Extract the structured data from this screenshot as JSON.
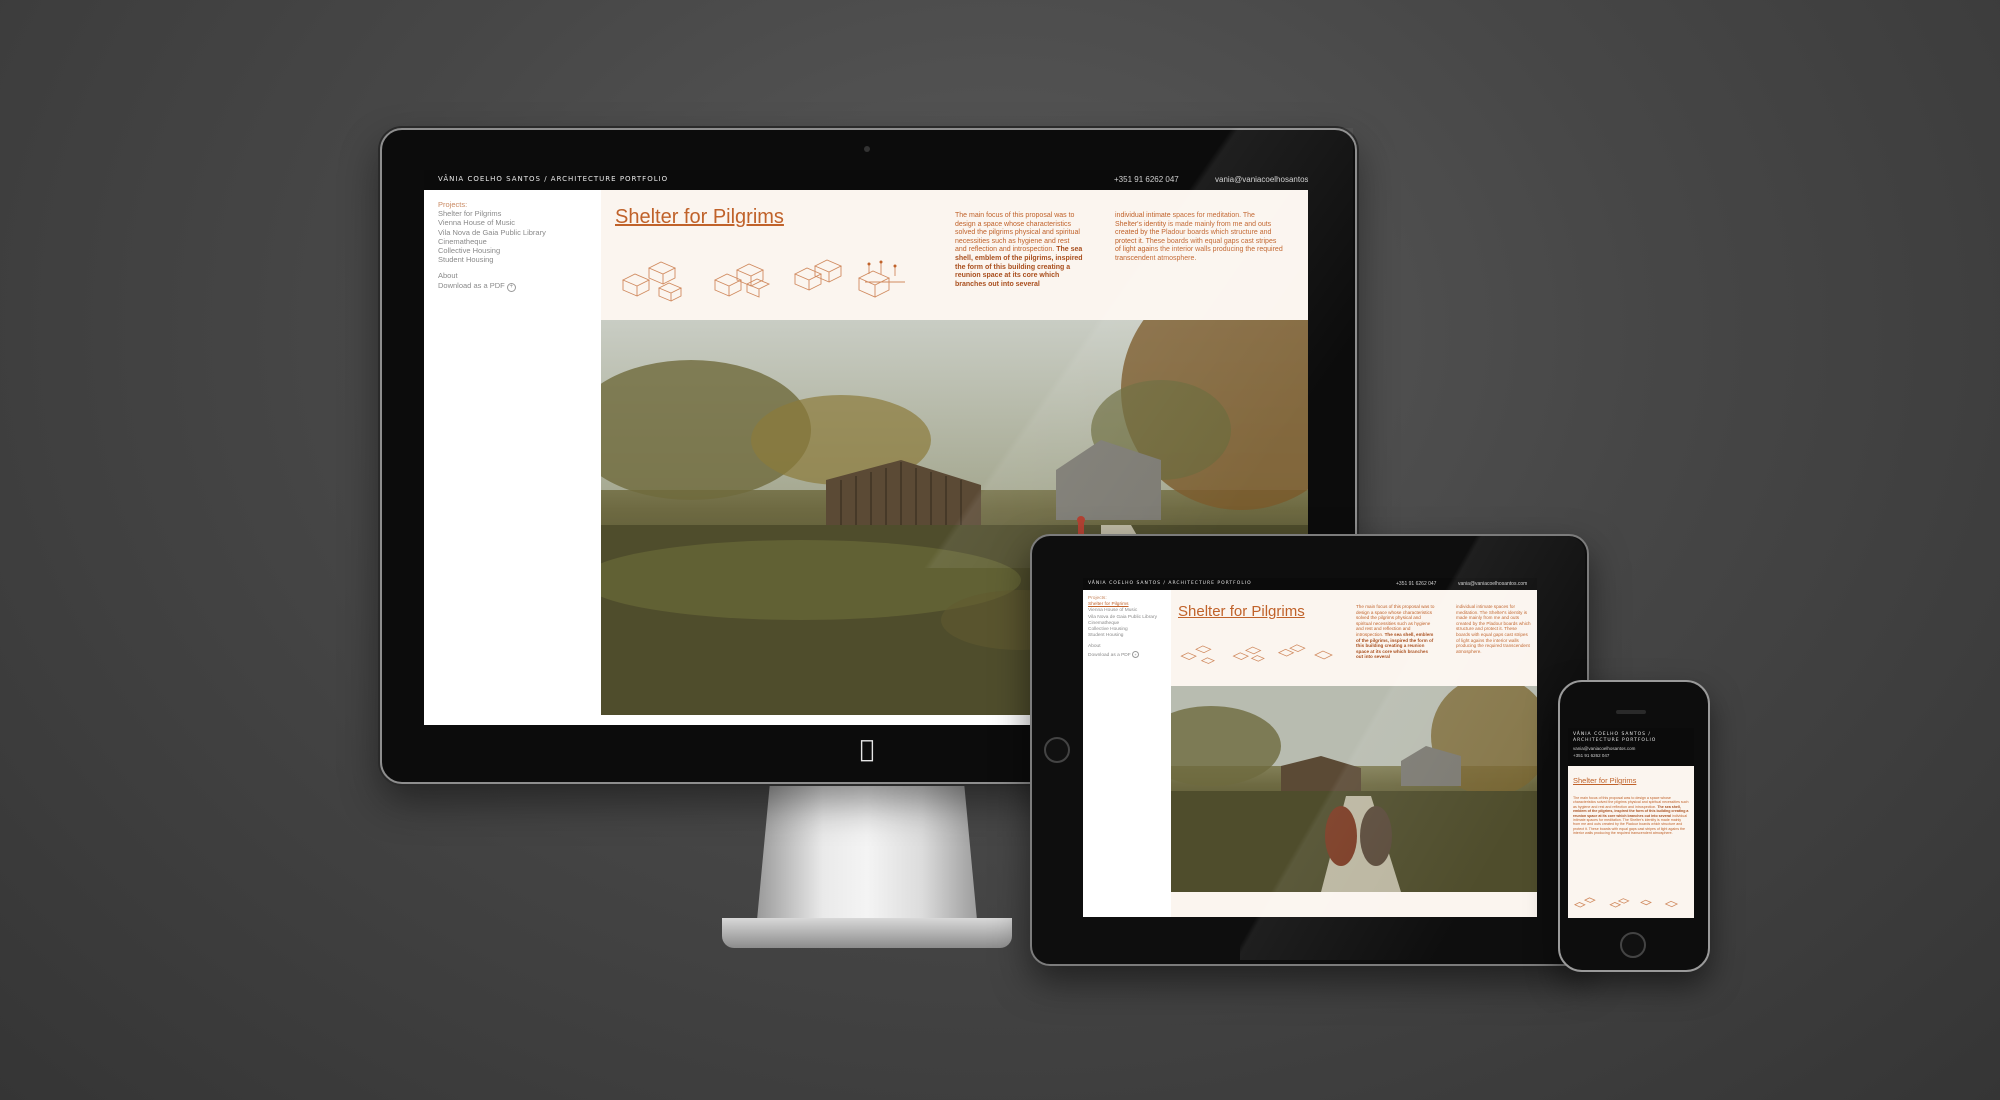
{
  "site": {
    "brand": "VÂNIA COELHO SANTOS  /  ARCHITECTURE PORTFOLIO",
    "brand_line1": "VÂNIA COELHO SANTOS  /",
    "brand_line2": "ARCHITECTURE PORTFOLIO",
    "phone": "+351 91 6262 047",
    "email": "vania@vaniacoelhosantos.com"
  },
  "nav": {
    "heading": "Projects:",
    "items": [
      "Shelter for Pilgrims",
      "Vienna House of Music",
      "Vila Nova de Gaia Public Library",
      "Cinematheque",
      "Collective Housing",
      "Student Housing"
    ],
    "about": "About",
    "download": "Download as a PDF",
    "download_icon": "+"
  },
  "project": {
    "title": "Shelter for Pilgrims",
    "text_col1_a": "The main focus of this proposal was to design a space whose characteristics solved the pilgrims physical and spiritual necessities such as hygiene and rest and reflection and introspection.",
    "text_col1_b": "The sea shell, emblem of the pilgrims, inspired the form of this building creating a reunion space at its core which branches out into several",
    "text_col2": "individual intimate spaces for meditation. The Shelter's identity is made mainly from me and outs created by the Pladour boards which structure and protect it. These boards with equal gaps cast stripes of light agains the interior walls producing the required transcendent atmosphere."
  },
  "colors": {
    "accent": "#c0622a",
    "page_bg": "#fbf5ef",
    "header_bg": "#0b0b0b"
  },
  "icons": {
    "apple": "apple-logo-icon"
  }
}
